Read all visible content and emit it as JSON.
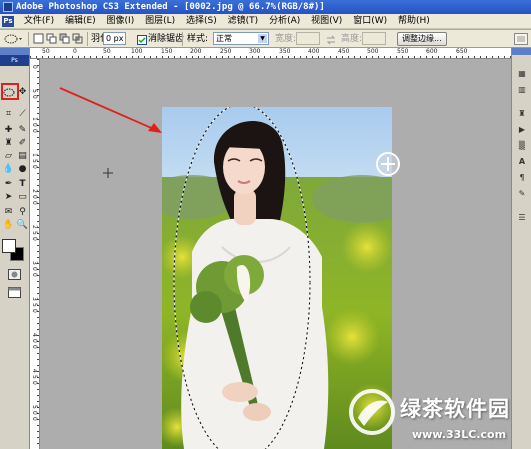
{
  "window": {
    "title": "Adobe Photoshop CS3 Extended - [0002.jpg @ 66.7%(RGB/8#)]",
    "app_badge": "Ps"
  },
  "menu": {
    "items": [
      "文件(F)",
      "编辑(E)",
      "图像(I)",
      "图层(L)",
      "选择(S)",
      "滤镜(T)",
      "分析(A)",
      "视图(V)",
      "窗口(W)",
      "帮助(H)"
    ]
  },
  "options_bar": {
    "feather_label": "羽化:",
    "feather_value": "0 px",
    "antialias_label": "消除锯齿",
    "antialias_checked": true,
    "style_label": "样式:",
    "style_value": "正常",
    "width_label": "宽度:",
    "height_label": "高度:",
    "refine_edge_button": "调整边缘..."
  },
  "ruler": {
    "h_ticks": [
      "50",
      "0",
      "50",
      "100",
      "150",
      "200",
      "250",
      "300",
      "350",
      "400",
      "450",
      "500",
      "550",
      "600",
      "650"
    ],
    "v_ticks": [
      "0",
      "5",
      "0",
      "1",
      "0",
      "0",
      "1",
      "5",
      "0",
      "2",
      "0",
      "0",
      "2",
      "5",
      "0",
      "3",
      "0",
      "0",
      "3",
      "5",
      "0",
      "4",
      "0",
      "0",
      "4",
      "5",
      "0",
      "5",
      "0",
      "0"
    ]
  },
  "tools": {
    "palette_badge": "Ps"
  },
  "watermark": {
    "text": "绿茶软件园",
    "url": "www.33LC.com"
  },
  "colors": {
    "title_bar": "#2a5acb",
    "menu_bg": "#ece9d8",
    "canvas_bg": "#adadad",
    "arrow": "#e0201c",
    "highlight_box": "#e0201c"
  }
}
